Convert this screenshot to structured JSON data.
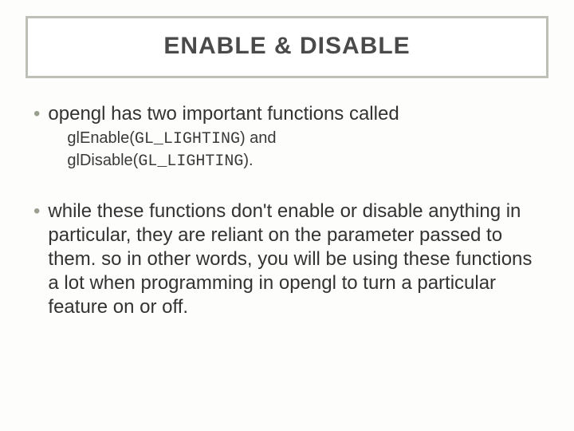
{
  "title": "ENABLE & DISABLE",
  "bullets": [
    {
      "lead": "opengl has two important functions called",
      "sub": {
        "part1": "glEnable(",
        "code1": "GL_LIGHTING",
        "part2": ") and",
        "part3": "glDisable(",
        "code2": "GL_LIGHTING",
        "part4": ")."
      }
    },
    {
      "text": "while these functions don't enable or disable anything in particular, they are reliant on the parameter passed to them. so in other words, you will be using these functions a lot when programming in opengl to turn a particular feature on or off."
    }
  ]
}
